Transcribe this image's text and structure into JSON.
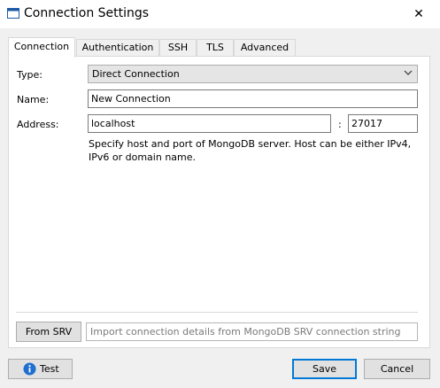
{
  "window": {
    "title": "Connection Settings",
    "close_glyph": "✕"
  },
  "tabs": [
    {
      "label": "Connection",
      "active": true
    },
    {
      "label": "Authentication",
      "active": false
    },
    {
      "label": "SSH",
      "active": false
    },
    {
      "label": "TLS",
      "active": false
    },
    {
      "label": "Advanced",
      "active": false
    }
  ],
  "form": {
    "type_label": "Type:",
    "type_value": "Direct Connection",
    "name_label": "Name:",
    "name_value": "New Connection",
    "address_label": "Address:",
    "host_value": "localhost",
    "port_separator": ":",
    "port_value": "27017",
    "help_text": "Specify host and port of MongoDB server. Host can be either IPv4, IPv6 or domain name."
  },
  "srv": {
    "button_label": "From SRV",
    "placeholder": "Import connection details from MongoDB SRV connection string"
  },
  "footer": {
    "test_label": "Test",
    "save_label": "Save",
    "cancel_label": "Cancel"
  },
  "icons": {
    "app": "window-icon",
    "info": "info-icon",
    "dropdown": "chevron-down-icon",
    "close": "close-icon"
  },
  "colors": {
    "accent": "#0078d7",
    "info_icon": "#1e6fd0",
    "panel": "#ffffff",
    "background": "#f0f0f0"
  }
}
